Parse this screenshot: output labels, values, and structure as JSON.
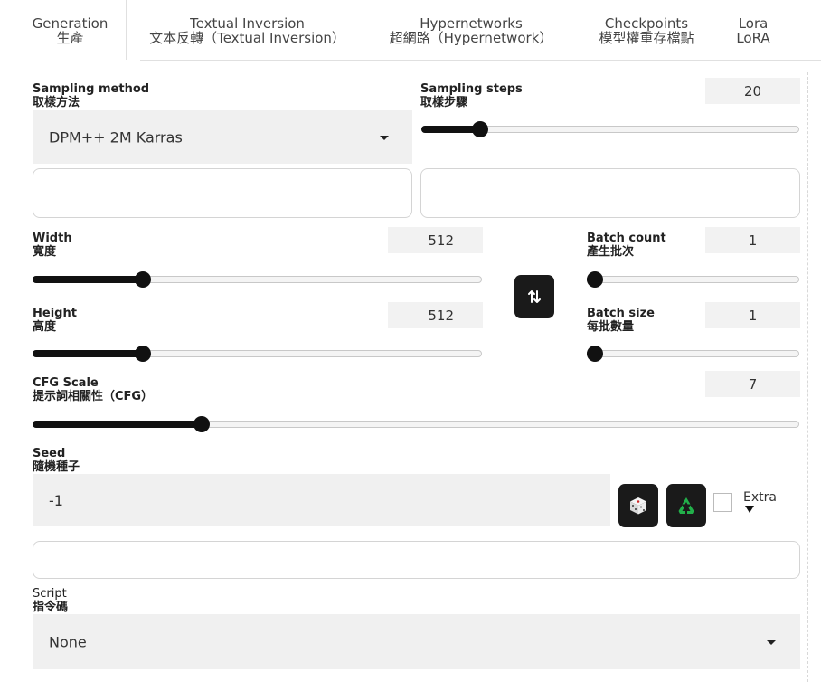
{
  "tabs": [
    {
      "label_en": "Generation",
      "label_zh": "生產"
    },
    {
      "label_en": "Textual Inversion",
      "label_zh": "文本反轉（Textual Inversion）"
    },
    {
      "label_en": "Hypernetworks",
      "label_zh": "超網路（Hypernetwork）"
    },
    {
      "label_en": "Checkpoints",
      "label_zh": "模型權重存檔點"
    },
    {
      "label_en": "Lora",
      "label_zh": "LoRA"
    }
  ],
  "sampling_method": {
    "label_en": "Sampling method",
    "label_zh": "取樣方法",
    "value": "DPM++ 2M Karras"
  },
  "sampling_steps": {
    "label_en": "Sampling steps",
    "label_zh": "取樣步驟",
    "value": "20",
    "fraction": 0.14
  },
  "width": {
    "label_en": "Width",
    "label_zh": "寬度",
    "value": "512",
    "fraction": 0.236
  },
  "height": {
    "label_en": "Height",
    "label_zh": "高度",
    "value": "512",
    "fraction": 0.236
  },
  "batch_count": {
    "label_en": "Batch count",
    "label_zh": "產生批次",
    "value": "1",
    "fraction": 0.0
  },
  "batch_size": {
    "label_en": "Batch size",
    "label_zh": "每批數量",
    "value": "1",
    "fraction": 0.0
  },
  "cfg_scale": {
    "label_en": "CFG Scale",
    "label_zh": "提示詞相關性（CFG）",
    "value": "7",
    "fraction": 0.214
  },
  "seed": {
    "label_en": "Seed",
    "label_zh": "隨機種子",
    "value": "-1",
    "extra_label": "Extra"
  },
  "script": {
    "label_en": "Script",
    "label_zh": "指令碼",
    "value": "None"
  },
  "icons": {
    "swap": "swap-dimensions-icon",
    "dice": "dice-icon",
    "recycle": "recycle-icon"
  },
  "colors": {
    "accent": "#111111",
    "field_bg": "#f0f0f0",
    "recycle_green": "#22b04a"
  }
}
